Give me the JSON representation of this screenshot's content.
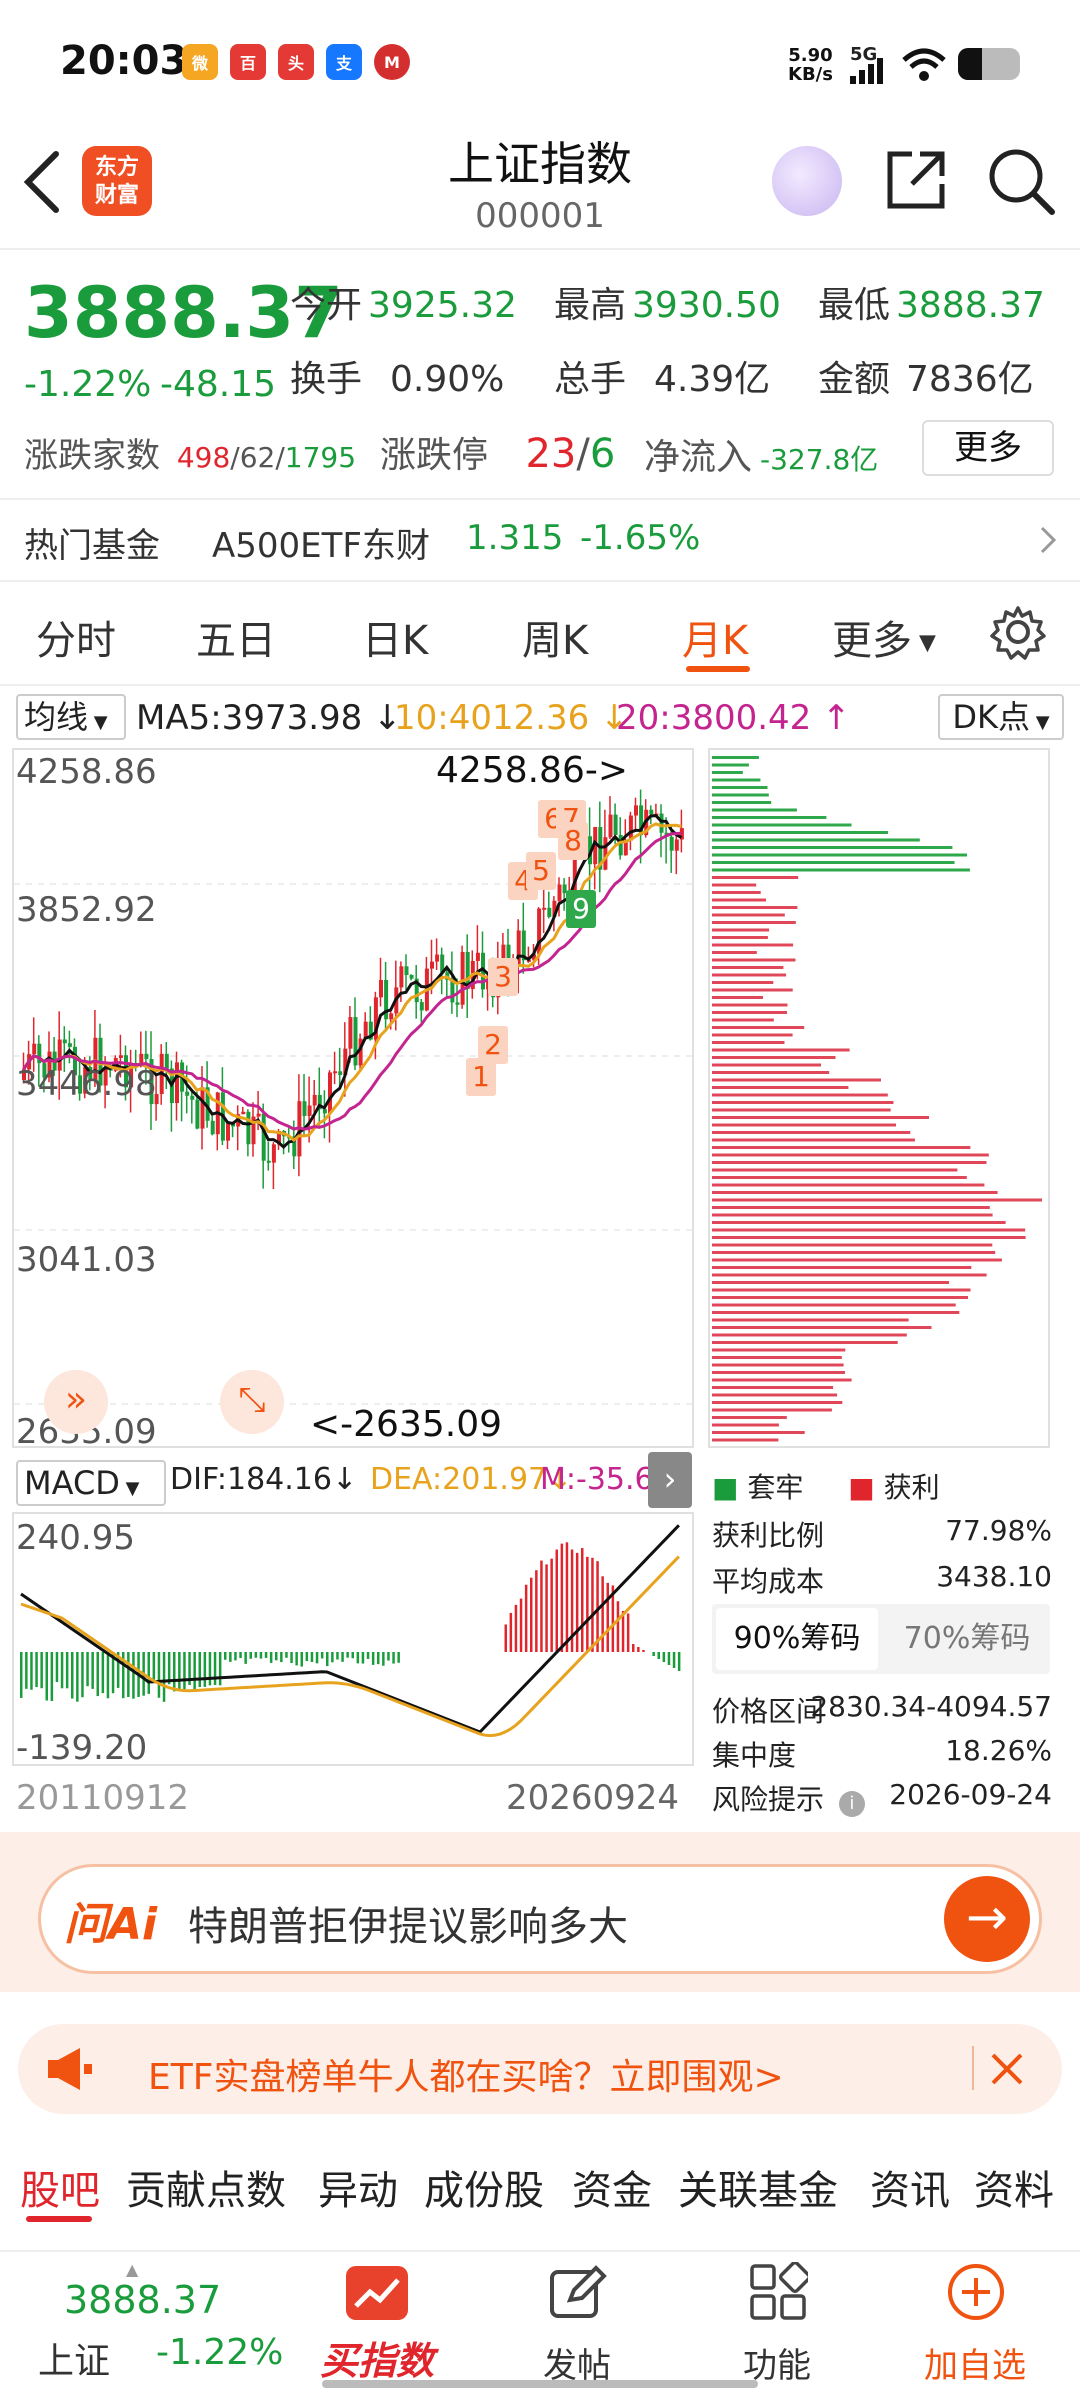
{
  "status": {
    "time": "20:03",
    "net_speed_value": "5.90",
    "net_speed_unit": "KB/s",
    "signal": "5G",
    "app_icons": [
      "weibo-icon",
      "baidu-map-icon",
      "toutiao-icon",
      "alipay-icon",
      "cmb-icon"
    ]
  },
  "header": {
    "logo_line1": "东方",
    "logo_line2": "财富",
    "title": "上证指数",
    "code": "000001"
  },
  "quote": {
    "price": "3888.37",
    "change_pct": "-1.22%",
    "change": "-48.15",
    "open_label": "今开",
    "open": "3925.32",
    "high_label": "最高",
    "high": "3930.50",
    "low_label": "最低",
    "low": "3888.37",
    "turnover_label": "换手",
    "turnover": "0.90%",
    "volume_label": "总手",
    "volume": "4.39亿",
    "amount_label": "金额",
    "amount": "7836亿",
    "breadth_label": "涨跌家数",
    "breadth_up": "498",
    "breadth_flat": "62",
    "breadth_down": "1795",
    "limit_label": "涨跌停",
    "limit_up": "23",
    "limit_down": "6",
    "netflow_label": "净流入",
    "netflow": "-327.8亿",
    "more_label": "更多"
  },
  "fund": {
    "label": "热门基金",
    "name": "A500ETF东财",
    "price": "1.315",
    "change": "-1.65%"
  },
  "tabs": [
    "分时",
    "五日",
    "日K",
    "周K",
    "月K",
    "更多"
  ],
  "active_tab": "月K",
  "ma": {
    "select_label": "均线",
    "ma5": "MA5:3973.98",
    "ma10": "10:4012.36",
    "ma20": "20:3800.42",
    "dk_label": "DK点"
  },
  "kline": {
    "y_labels": [
      "4258.86",
      "3852.92",
      "3446.98",
      "3041.03",
      "2635.09"
    ],
    "high_marker": "4258.86->",
    "low_marker": "<-2635.09",
    "signals": [
      "1",
      "2",
      "3",
      "4",
      "5",
      "6",
      "7",
      "8"
    ],
    "sell_signal": "9"
  },
  "macd": {
    "select_label": "MACD",
    "dif": "DIF:184.16",
    "dea": "DEA:201.97",
    "m": "M:-35.62",
    "y_top": "240.95",
    "y_bottom": "-139.20",
    "date_left": "20110912",
    "date_right": "20260924"
  },
  "chips": {
    "legend_trapped": "套牢",
    "legend_profit": "获利",
    "profit_ratio_label": "获利比例",
    "profit_ratio": "77.98%",
    "avg_cost_label": "平均成本",
    "avg_cost": "3438.10",
    "tab90": "90%筹码",
    "tab70": "70%筹码",
    "range_label": "价格区间",
    "range": "2830.34-4094.57",
    "concentration_label": "集中度",
    "concentration": "18.26%",
    "risk_label": "风险提示",
    "risk_date": "2026-09-24"
  },
  "ai": {
    "brand": "问Ai",
    "prompt": "特朗普拒伊提议影响多大"
  },
  "notice": {
    "text": "ETF实盘榜单牛人都在买啥？立即围观>"
  },
  "bottom_tabs": [
    "股吧",
    "贡献点数",
    "异动",
    "成份股",
    "资金",
    "关联基金",
    "资讯",
    "资料"
  ],
  "nav": {
    "ticker_price": "3888.37",
    "ticker_name": "上证",
    "ticker_change": "-1.22%",
    "buy_index": "买指数",
    "post": "发帖",
    "functions": "功能",
    "add_watch": "加自选"
  },
  "colors": {
    "up": "#e0262c",
    "down": "#1a9c3c",
    "accent": "#f0520f",
    "ma10": "#e8a31e",
    "ma20": "#c4248f"
  }
}
